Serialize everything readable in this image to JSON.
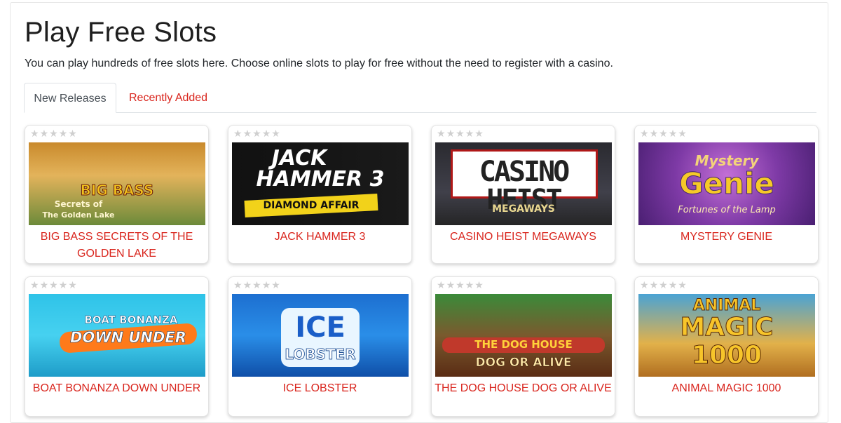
{
  "page": {
    "title": "Play Free Slots",
    "intro": "You can play hundreds of free slots here. Choose online slots to play for free without the need to register with a casino."
  },
  "tabs": [
    {
      "label": "New Releases",
      "active": true
    },
    {
      "label": "Recently Added",
      "active": false
    }
  ],
  "colors": {
    "link": "#d9251d",
    "star_empty": "#cfcfcf"
  },
  "games": [
    {
      "title": "BIG BASS SECRETS OF THE GOLDEN LAKE",
      "rating": 0,
      "thumb_text": [
        "BIG BASS",
        "Secrets of",
        "The Golden Lake"
      ]
    },
    {
      "title": "JACK HAMMER 3",
      "rating": 0,
      "thumb_text": [
        "JACK",
        "HAMMER 3",
        "DIAMOND AFFAIR"
      ]
    },
    {
      "title": "CASINO HEIST MEGAWAYS",
      "rating": 0,
      "thumb_text": [
        "CASINO HEIST",
        "MEGAWAYS"
      ]
    },
    {
      "title": "MYSTERY GENIE",
      "rating": 0,
      "thumb_text": [
        "Mystery",
        "Genie",
        "Fortunes of the Lamp"
      ]
    },
    {
      "title": "BOAT BONANZA DOWN UNDER",
      "rating": 0,
      "thumb_text": [
        "BOAT BONANZA",
        "DOWN UNDER"
      ]
    },
    {
      "title": "ICE LOBSTER",
      "rating": 0,
      "thumb_text": [
        "ICE",
        "LOBSTER"
      ]
    },
    {
      "title": "THE DOG HOUSE DOG OR ALIVE",
      "rating": 0,
      "thumb_text": [
        "THE DOG HOUSE",
        "DOG OR ALIVE"
      ]
    },
    {
      "title": "ANIMAL MAGIC 1000",
      "rating": 0,
      "thumb_text": [
        "ANIMAL",
        "MAGIC",
        "1000"
      ]
    }
  ]
}
